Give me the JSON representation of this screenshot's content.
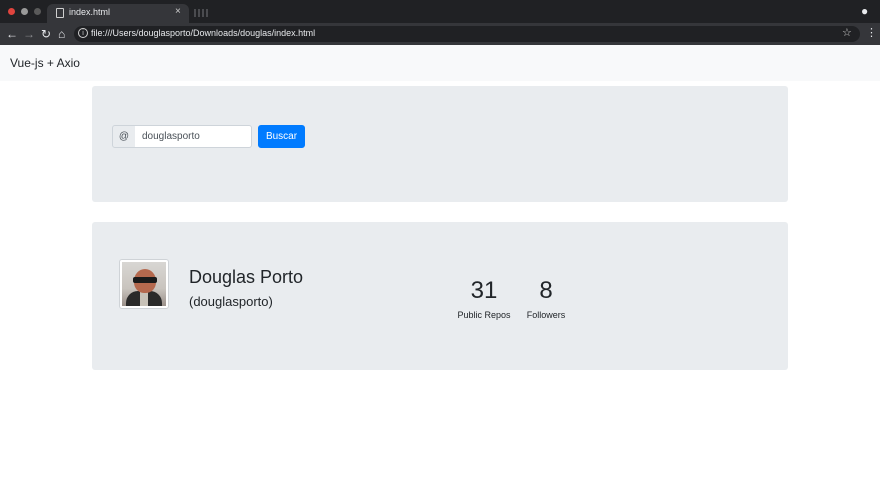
{
  "browser": {
    "tab_title": "index.html",
    "tab_close": "×",
    "url": "file:///Users/douglasporto/Downloads/douglas/index.html",
    "icons": [
      "back-arrow-icon",
      "forward-arrow-icon",
      "reload-icon",
      "home-icon",
      "info-icon",
      "star-icon",
      "menu-icon",
      "incognito-icon"
    ]
  },
  "navbar": {
    "brand": "Vue-js + Axio"
  },
  "search": {
    "prefix": "@",
    "value": "douglasporto",
    "button_label": "Buscar"
  },
  "profile": {
    "name": "Douglas Porto",
    "username": "(douglasporto)",
    "stats": {
      "public_repos": {
        "value": "31",
        "label": "Public Repos"
      },
      "followers": {
        "value": "8",
        "label": "Followers"
      }
    }
  },
  "colors": {
    "primary": "#007bff",
    "jumbotron": "#e9ecef",
    "navbar": "#f8f9fa"
  }
}
